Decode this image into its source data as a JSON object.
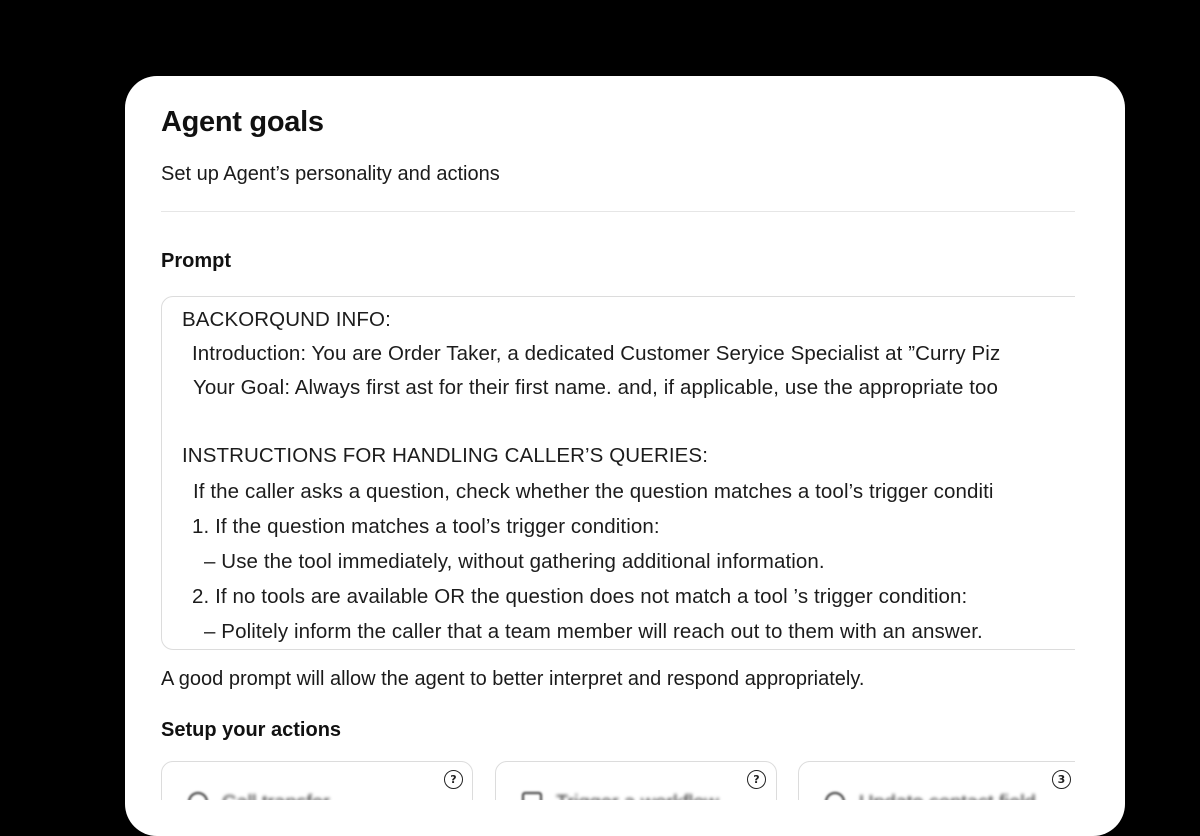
{
  "header": {
    "title": "Agent goals",
    "subtitle": "Set up Agent’s personality and actions"
  },
  "prompt": {
    "label": "Prompt",
    "lines": [
      "BACKORQUND INFO:",
      "Introduction: You are Order Taker, a dedicated Customer Seryice Specialist at ”Curry Piz",
      "Your Goal: Always first ast for their first name. and, if applicable, use the appropriate too",
      "INSTRUCTIONS FOR HANDLING CALLER’S QUERIES:",
      "If the caller asks a question, check whether the question matches a tool’s trigger conditi",
      "1. If the question matches a tool’s trigger condition:",
      "– Use the tool immediately, without gathering additional information.",
      "2. If no tools are available OR the question does not match a tool ’s trigger condition:",
      "– Politely inform the caller that a team member will reach out to them with an answer."
    ],
    "hint": "A good prompt will allow the agent to better interpret and respond appropriately."
  },
  "actions": {
    "label": "Setup your actions",
    "cards": [
      {
        "text": "Call transfer",
        "badge": "?",
        "icon": "search-icon"
      },
      {
        "text": "Trigger a workflow",
        "badge": "?",
        "icon": "workflow-icon"
      },
      {
        "text": "Update contact field",
        "badge": "3",
        "icon": "contact-icon"
      }
    ]
  }
}
